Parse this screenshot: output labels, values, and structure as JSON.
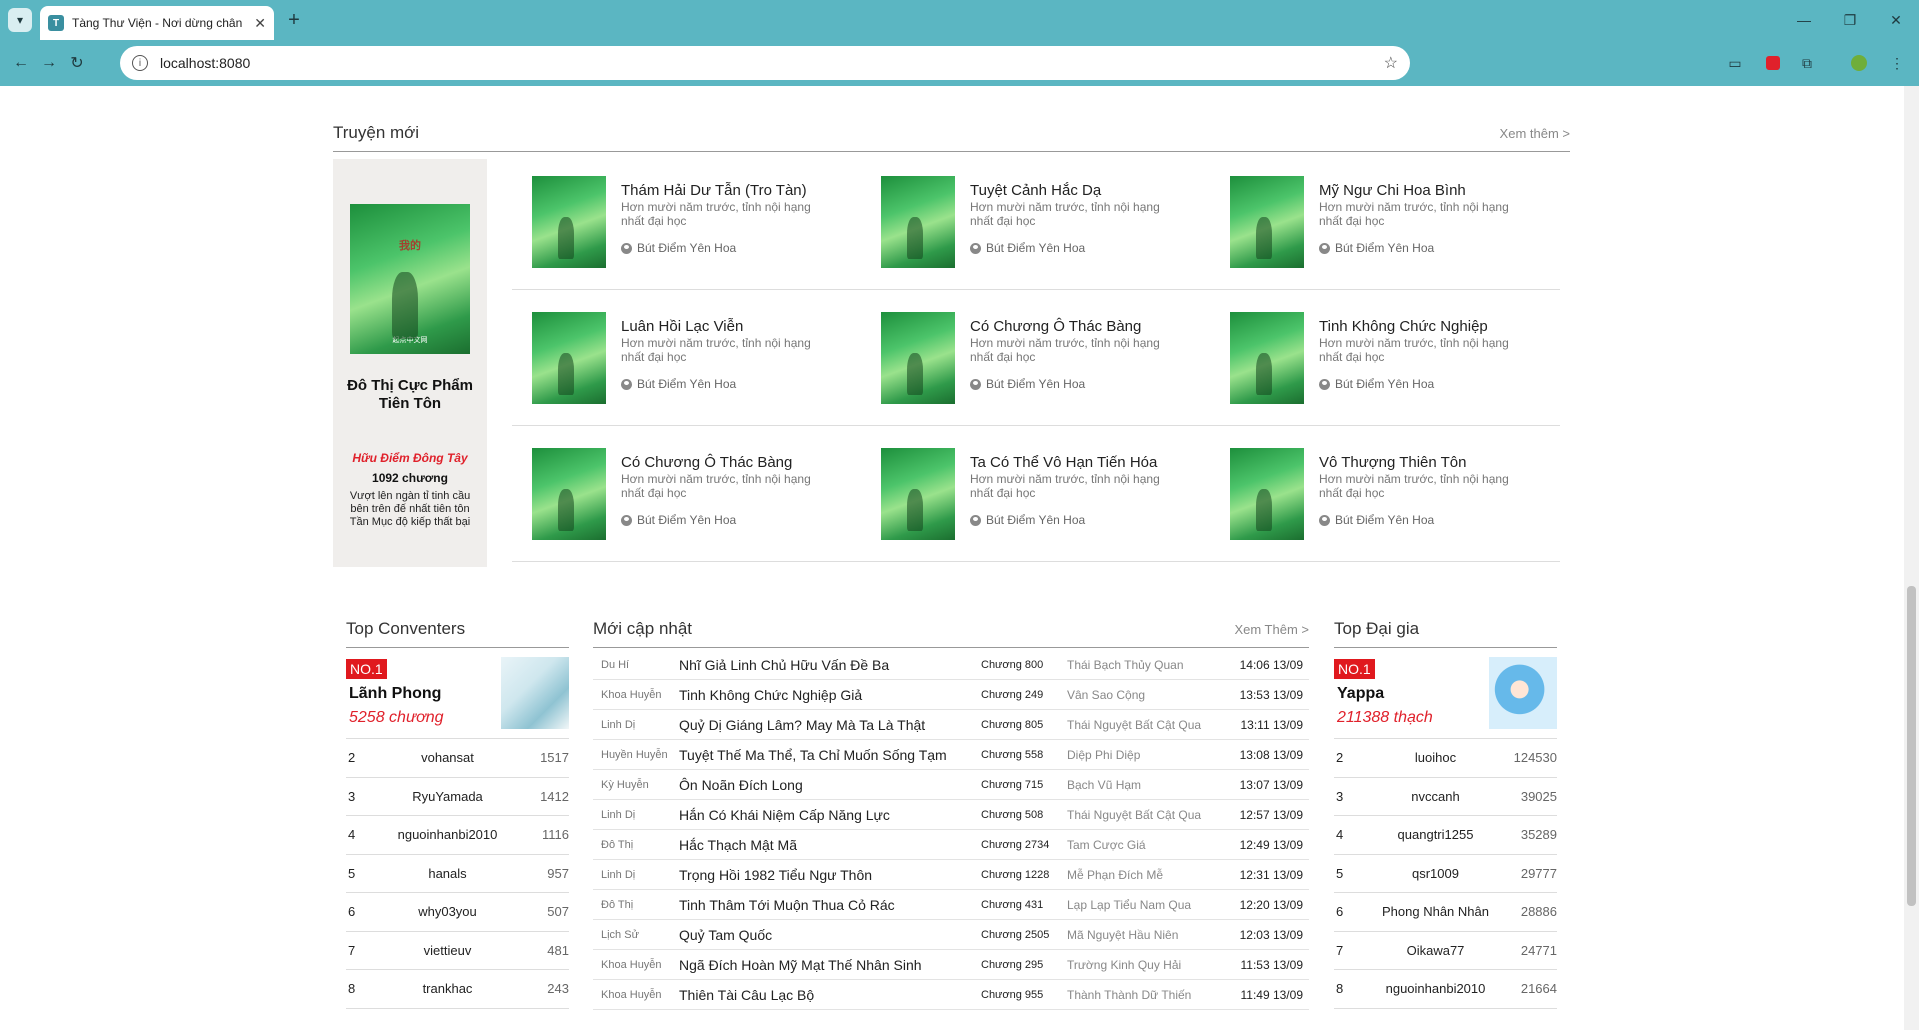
{
  "browser": {
    "tab_title": "Tàng Thư Viện - Nơi dừng chân",
    "url": "localhost:8080"
  },
  "new_stories": {
    "heading": "Truyện mới",
    "more": "Xem thêm >",
    "featured": {
      "cover_text": "我的",
      "cover_footer": "起点中文网",
      "title": "Đô Thị Cực Phẩm Tiên Tôn",
      "author": "Hữu Điểm Đông Tây",
      "chapters": "1092 chương",
      "description": "Vượt lên ngàn tỉ tinh cầu bên trên đế nhất tiên tôn Tần Mục độ kiếp thất bại"
    },
    "books": [
      {
        "title": "Thám Hải Dư Tẫn (Tro Tàn)",
        "desc": "Hơn mười năm trước, tỉnh nội hạng nhất đại học",
        "author": "Bút Điểm Yên Hoa"
      },
      {
        "title": "Tuyệt Cảnh Hắc Dạ",
        "desc": "Hơn mười năm trước, tỉnh nội hạng nhất đại học",
        "author": "Bút Điểm Yên Hoa"
      },
      {
        "title": "Mỹ Ngư Chi Hoa Bình",
        "desc": "Hơn mười năm trước, tỉnh nội hạng nhất đại học",
        "author": "Bút Điểm Yên Hoa"
      },
      {
        "title": "Luân Hồi Lạc Viễn",
        "desc": "Hơn mười năm trước, tỉnh nội hạng nhất đại học",
        "author": "Bút Điểm Yên Hoa"
      },
      {
        "title": "Có Chương Ô Thác Bàng",
        "desc": "Hơn mười năm trước, tỉnh nội hạng nhất đại học",
        "author": "Bút Điểm Yên Hoa"
      },
      {
        "title": "Tinh Không Chức Nghiệp",
        "desc": "Hơn mười năm trước, tỉnh nội hạng nhất đại học",
        "author": "Bút Điểm Yên Hoa"
      },
      {
        "title": "Có Chương Ô Thác Bàng",
        "desc": "Hơn mười năm trước, tỉnh nội hạng nhất đại học",
        "author": "Bút Điểm Yên Hoa"
      },
      {
        "title": "Ta Có Thể Vô Hạn Tiến Hóa",
        "desc": "Hơn mười năm trước, tỉnh nội hạng nhất đại học",
        "author": "Bút Điểm Yên Hoa"
      },
      {
        "title": "Vô Thượng Thiên Tôn",
        "desc": "Hơn mười năm trước, tỉnh nội hạng nhất đại học",
        "author": "Bút Điểm Yên Hoa"
      }
    ]
  },
  "top_converters": {
    "heading": "Top Conventers",
    "badge": "NO.1",
    "top_name": "Lãnh Phong",
    "top_value": "5258 chương",
    "rows": [
      {
        "n": "2",
        "u": "vohansat",
        "c": "1517"
      },
      {
        "n": "3",
        "u": "RyuYamada",
        "c": "1412"
      },
      {
        "n": "4",
        "u": "nguoinhanbi2010",
        "c": "1116"
      },
      {
        "n": "5",
        "u": "hanals",
        "c": "957"
      },
      {
        "n": "6",
        "u": "why03you",
        "c": "507"
      },
      {
        "n": "7",
        "u": "viettieuv",
        "c": "481"
      },
      {
        "n": "8",
        "u": "trankhac",
        "c": "243"
      }
    ]
  },
  "recent_updates": {
    "heading": "Mới cập nhật",
    "more": "Xem Thêm >",
    "rows": [
      {
        "g": "Du Hí",
        "t": "Nhĩ Giả Linh Chủ Hữu Vấn Đề Ba",
        "ch": "Chương 800",
        "a": "Thái Bạch Thủy Quan",
        "tm": "14:06 13/09"
      },
      {
        "g": "Khoa Huyễn",
        "t": "Tinh Không Chức Nghiệp Giả",
        "ch": "Chương 249",
        "a": "Vân Sao Cộng",
        "tm": "13:53 13/09"
      },
      {
        "g": "Linh Dị",
        "t": "Quỷ Dị Giáng Lâm? May Mà Ta Là Thật",
        "ch": "Chương 805",
        "a": "Thái Nguyệt Bất Cật Qua",
        "tm": "13:11 13/09"
      },
      {
        "g": "Huyền Huyễn",
        "t": "Tuyệt Thế Ma Thể, Ta Chỉ Muốn Sống Tạm",
        "ch": "Chương 558",
        "a": "Diệp Phi Diệp",
        "tm": "13:08 13/09"
      },
      {
        "g": "Kỳ Huyễn",
        "t": "Ôn Noãn Đích Long",
        "ch": "Chương 715",
        "a": "Bạch Vũ Hạm",
        "tm": "13:07 13/09"
      },
      {
        "g": "Linh Dị",
        "t": "Hắn Có Khái Niệm Cấp Năng Lực",
        "ch": "Chương 508",
        "a": "Thái Nguyệt Bất Cật Qua",
        "tm": "12:57 13/09"
      },
      {
        "g": "Đô Thị",
        "t": "Hắc Thạch Mật Mã",
        "ch": "Chương 2734",
        "a": "Tam Cược Giá",
        "tm": "12:49 13/09"
      },
      {
        "g": "Linh Dị",
        "t": "Trọng Hồi 1982 Tiểu Ngư Thôn",
        "ch": "Chương 1228",
        "a": "Mễ Phạn Đích Mễ",
        "tm": "12:31 13/09"
      },
      {
        "g": "Đô Thị",
        "t": "Tinh Thâm Tới Muộn Thua Cỏ Rác",
        "ch": "Chương 431",
        "a": "Lạp Lạp Tiểu Nam Qua",
        "tm": "12:20 13/09"
      },
      {
        "g": "Lịch Sử",
        "t": "Quỷ Tam Quốc",
        "ch": "Chương 2505",
        "a": "Mã Nguyệt Hầu Niên",
        "tm": "12:03 13/09"
      },
      {
        "g": "Khoa Huyễn",
        "t": "Ngã Đích Hoàn Mỹ Mạt Thế Nhân Sinh",
        "ch": "Chương 295",
        "a": "Trường Kinh Quy Hải",
        "tm": "11:53 13/09"
      },
      {
        "g": "Khoa Huyễn",
        "t": "Thiên Tài Câu Lạc Bộ",
        "ch": "Chương 955",
        "a": "Thành Thành Dữ Thiến",
        "tm": "11:49 13/09"
      }
    ]
  },
  "top_rich": {
    "heading": "Top Đại gia",
    "badge": "NO.1",
    "top_name": "Yappa",
    "top_value": "211388 thạch",
    "rows": [
      {
        "n": "2",
        "u": "luoihoc",
        "c": "124530"
      },
      {
        "n": "3",
        "u": "nvccanh",
        "c": "39025"
      },
      {
        "n": "4",
        "u": "quangtri1255",
        "c": "35289"
      },
      {
        "n": "5",
        "u": "qsr1009",
        "c": "29777"
      },
      {
        "n": "6",
        "u": "Phong Nhân Nhân",
        "c": "28886"
      },
      {
        "n": "7",
        "u": "Oikawa77",
        "c": "24771"
      },
      {
        "n": "8",
        "u": "nguoinhanbi2010",
        "c": "21664"
      }
    ]
  }
}
